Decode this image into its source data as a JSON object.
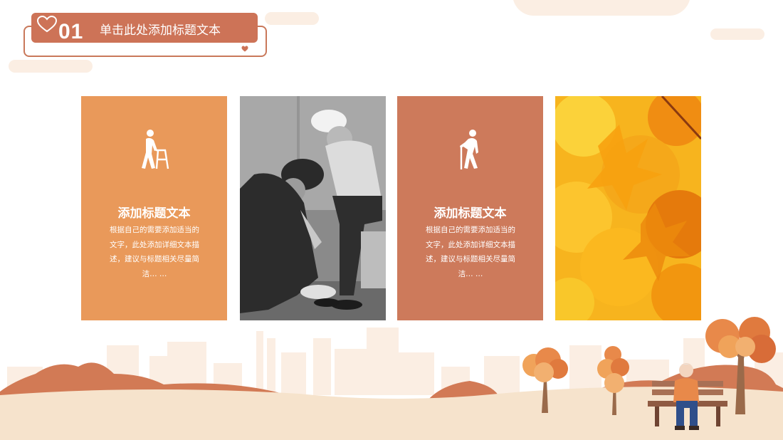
{
  "header": {
    "number": "01",
    "title": "单击此处添加标题文本",
    "heart_icon": "heart-outline-icon"
  },
  "cards": [
    {
      "type": "text",
      "icon": "elderly-walker-icon",
      "title": "添加标题文本",
      "desc": "根据自己的需要添加适当的文字，此处添加详细文本描述，建议与标题相关尽量简洁… …",
      "color": "#e9995a"
    },
    {
      "type": "photo",
      "description_icon": "elderly-couple-photo",
      "color": "#7d7d7d"
    },
    {
      "type": "text",
      "icon": "elderly-cane-icon",
      "title": "添加标题文本",
      "desc": "根据自己的需要添加适当的文字，此处添加详细文本描述，建议与标题相关尽量简洁… …",
      "color": "#cd7a5b"
    },
    {
      "type": "photo",
      "description_icon": "autumn-leaves-photo",
      "color": "#f5a516"
    }
  ],
  "colors": {
    "accent": "#cd7357",
    "orange": "#e9995a",
    "ground": "#f6e3cc",
    "city": "#fbeee3"
  }
}
